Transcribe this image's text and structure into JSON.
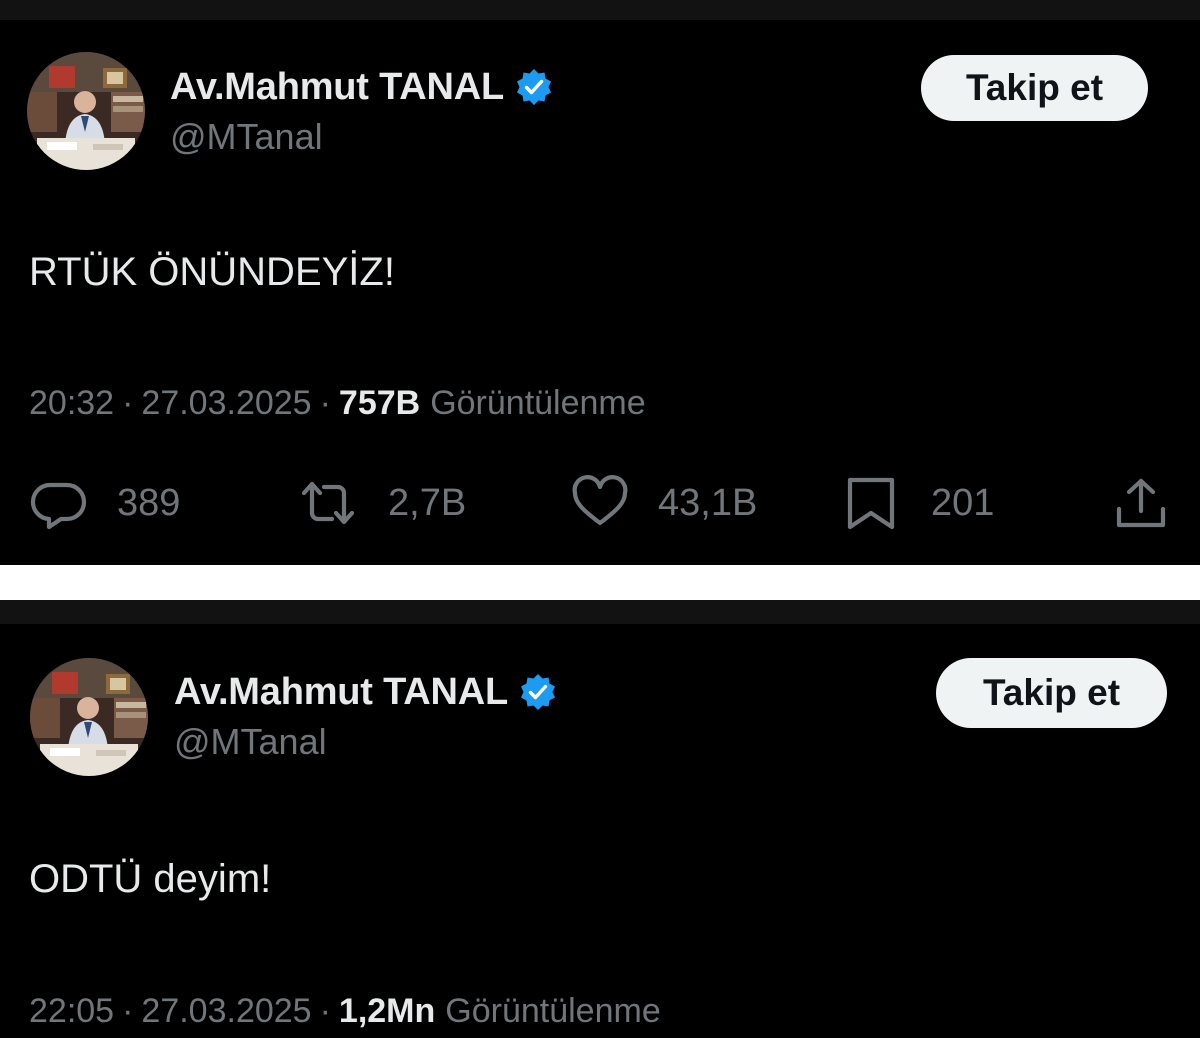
{
  "tweets": [
    {
      "author": {
        "name": "Av.Mahmut TANAL",
        "handle": "@MTanal",
        "verified": true
      },
      "follow_label": "Takip et",
      "text": "RTÜK ÖNÜNDEYİZ!",
      "time": "20:32",
      "date": "27.03.2025",
      "views_count": "757B",
      "views_label": "Görüntülenme",
      "stats": {
        "replies": "389",
        "reposts": "2,7B",
        "likes": "43,1B",
        "bookmarks": "201"
      }
    },
    {
      "author": {
        "name": "Av.Mahmut TANAL",
        "handle": "@MTanal",
        "verified": true
      },
      "follow_label": "Takip et",
      "text": "ODTÜ deyim!",
      "time": "22:05",
      "date": "27.03.2025",
      "views_count": "1,2Mn",
      "views_label": "Görüntülenme"
    }
  ],
  "separator": "·",
  "icons": {
    "verified": "verified-badge-icon",
    "reply": "reply-bubble-icon",
    "repost": "repost-arrows-icon",
    "like": "heart-icon",
    "bookmark": "bookmark-icon",
    "share": "share-upload-icon"
  },
  "colors": {
    "background": "#000000",
    "text_primary": "#e7e9ea",
    "text_secondary": "#71767b",
    "verified_blue": "#1d9bf0",
    "follow_button_bg": "#eff3f4",
    "follow_button_text": "#0f1419"
  }
}
